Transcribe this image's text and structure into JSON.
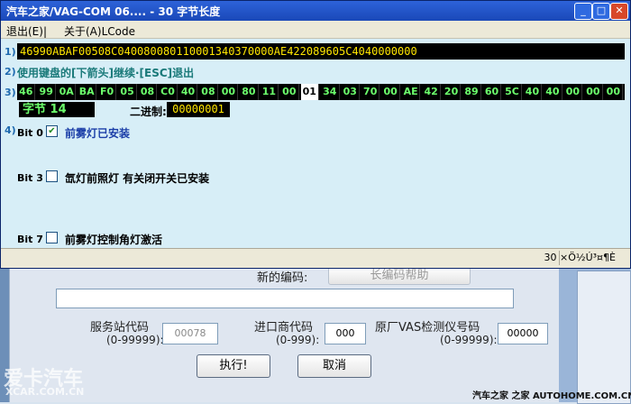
{
  "window": {
    "title": "汽车之家/VAG-COM 06.... - 30 字节长度",
    "minimize": "_",
    "maximize": "□",
    "close": "✕"
  },
  "menu": [
    "退出(E)|",
    "关于(A)LCode"
  ],
  "rows": {
    "r1": "1)",
    "r2": "2)",
    "r3": "3)",
    "r4": "4)"
  },
  "hex_string": "46990ABAF00508C040080080110001340370000AE422089605C4040000000",
  "instruction": "使用键盘的[下箭头]继续·[ESC]退出",
  "bytes": [
    "46",
    "99",
    "0A",
    "BA",
    "F0",
    "05",
    "08",
    "C0",
    "40",
    "08",
    "00",
    "80",
    "11",
    "00",
    "01",
    "34",
    "03",
    "70",
    "00",
    "AE",
    "42",
    "20",
    "89",
    "60",
    "5C",
    "40",
    "40",
    "00",
    "00",
    "00"
  ],
  "selected_byte_index": 14,
  "byte_label": "字节 14",
  "binary_label": "二进制:",
  "binary_value": "00000001",
  "bits": [
    {
      "label": "Bit 0",
      "checked": true,
      "text": "前雾灯已安装",
      "color": "#1c3fa8"
    },
    {
      "label": "Bit 3",
      "checked": false,
      "text": "氙灯前照灯 有关闭开关已安装",
      "color": "#000000"
    },
    {
      "label": "Bit 7",
      "checked": false,
      "text": "前雾灯控制角灯激活",
      "color": "#000000"
    }
  ],
  "status": "30 ×Ö½Ú³¤¶È",
  "background": {
    "new_code_label": "新的编码:",
    "long_code_help": "长编码帮助",
    "service_code_label": "服务站代码",
    "service_code_range": "(0-99999):",
    "service_code_value": "00078",
    "importer_label": "进口商代码",
    "importer_range": "(0-999):",
    "importer_value": "000",
    "vas_label": "原厂VAS检测仪号码",
    "vas_range": "(0-99999):",
    "vas_value": "00000",
    "execute_button": "执行!",
    "cancel_button": "取消"
  },
  "watermarks": {
    "left": "爱卡汽车",
    "left_url": "XCAR.COM.CN",
    "right": "汽车之家 之家 AUTOHOME.COM.CN"
  }
}
